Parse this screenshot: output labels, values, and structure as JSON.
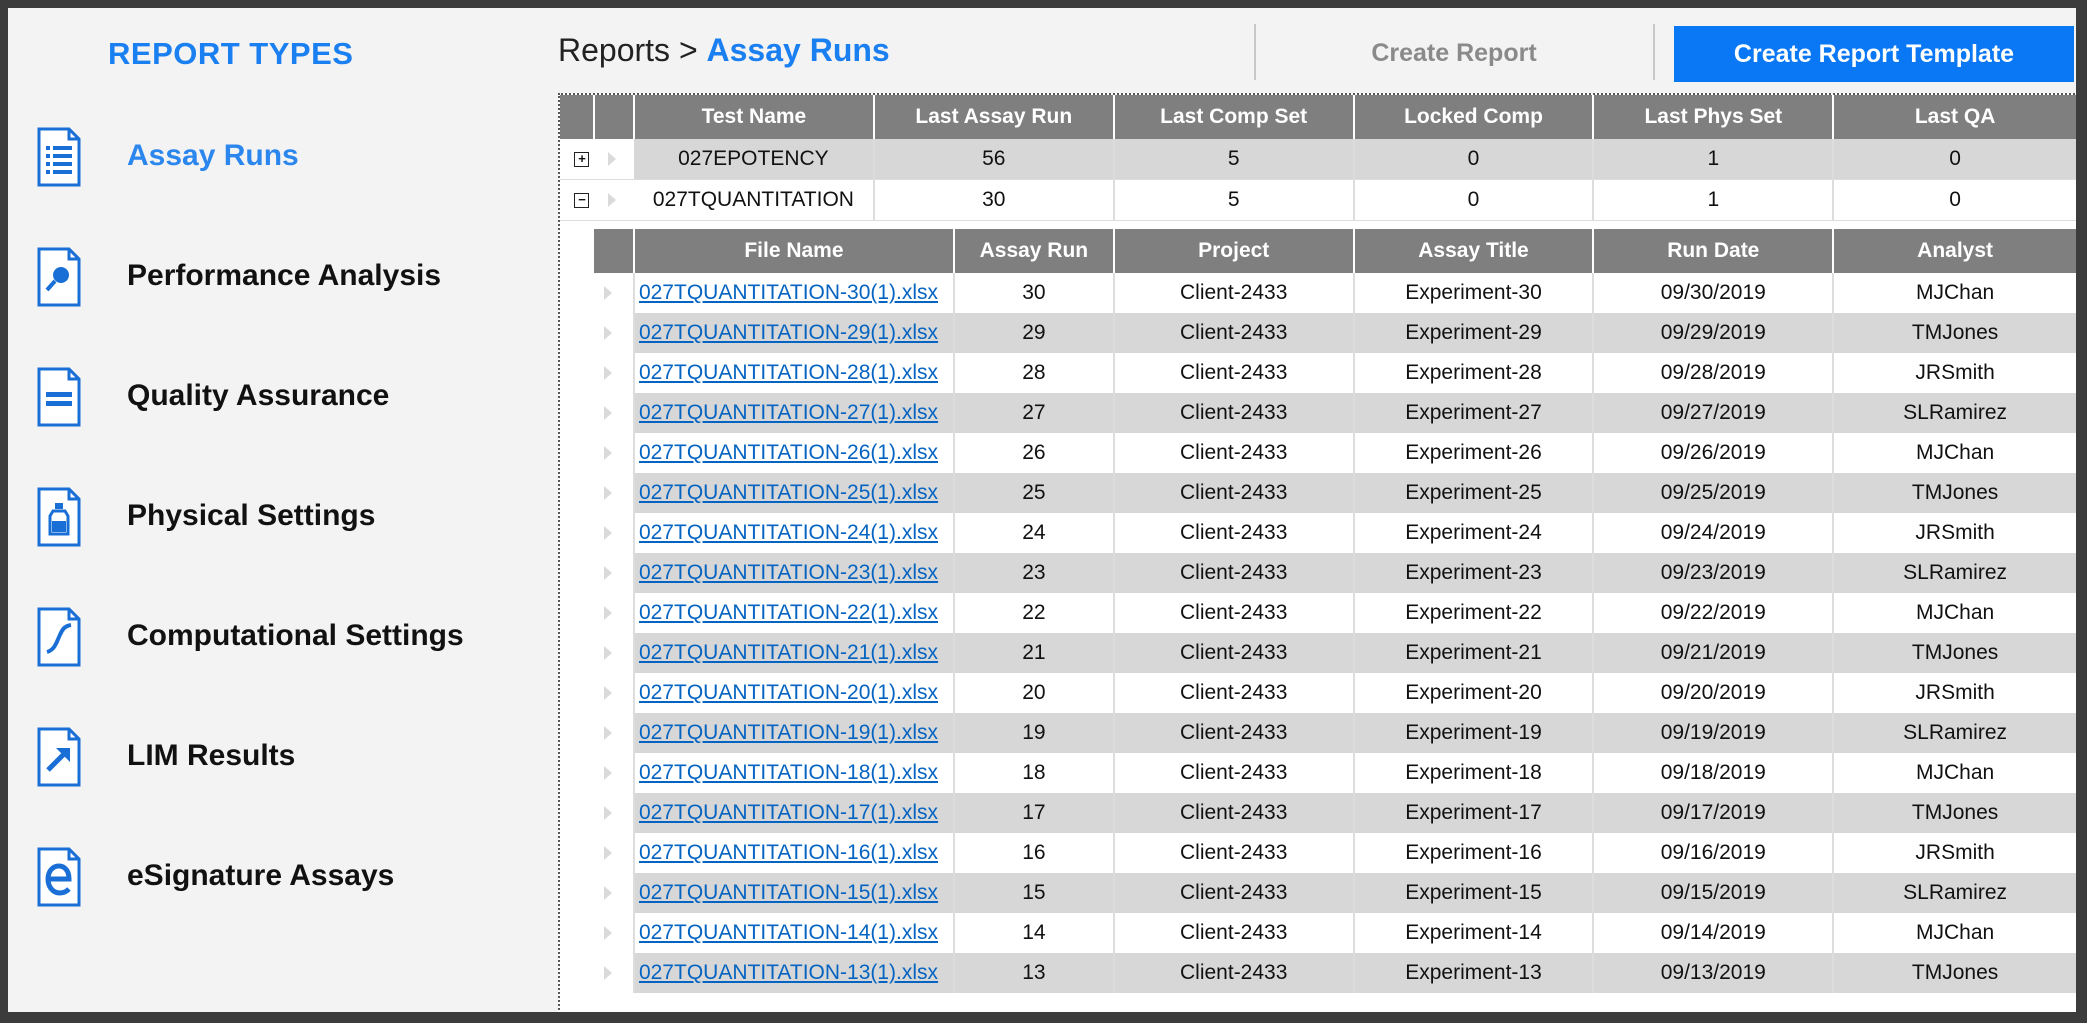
{
  "sidebar": {
    "title": "REPORT TYPES",
    "items": [
      {
        "label": "Assay Runs",
        "icon": "list-document-icon",
        "active": true
      },
      {
        "label": "Performance Analysis",
        "icon": "magnifier-document-icon"
      },
      {
        "label": "Quality Assurance",
        "icon": "equals-document-icon"
      },
      {
        "label": "Physical Settings",
        "icon": "bottle-document-icon"
      },
      {
        "label": "Computational Settings",
        "icon": "curve-document-icon"
      },
      {
        "label": "LIM Results",
        "icon": "arrow-document-icon"
      },
      {
        "label": "eSignature Assays",
        "icon": "e-document-icon"
      }
    ]
  },
  "header": {
    "breadcrumb_root": "Reports",
    "breadcrumb_sep": ">",
    "breadcrumb_current": "Assay Runs",
    "create_report": "Create Report",
    "create_template": "Create Report Template"
  },
  "master": {
    "columns": [
      "Test Name",
      "Last Assay Run",
      "Last Comp Set",
      "Locked Comp",
      "Last Phys Set",
      "Last QA"
    ],
    "rows": [
      {
        "expander": "+",
        "cells": [
          "027EPOTENCY",
          "56",
          "5",
          "0",
          "1",
          "0"
        ]
      },
      {
        "expander": "−",
        "cells": [
          "027TQUANTITATION",
          "30",
          "5",
          "0",
          "1",
          "0"
        ]
      }
    ]
  },
  "detail": {
    "columns": [
      "File Name",
      "Assay Run",
      "Project",
      "Assay Title",
      "Run Date",
      "Analyst"
    ],
    "rows": [
      [
        "027TQUANTITATION-30(1).xlsx",
        "30",
        "Client-2433",
        "Experiment-30",
        "09/30/2019",
        "MJChan"
      ],
      [
        "027TQUANTITATION-29(1).xlsx",
        "29",
        "Client-2433",
        "Experiment-29",
        "09/29/2019",
        "TMJones"
      ],
      [
        "027TQUANTITATION-28(1).xlsx",
        "28",
        "Client-2433",
        "Experiment-28",
        "09/28/2019",
        "JRSmith"
      ],
      [
        "027TQUANTITATION-27(1).xlsx",
        "27",
        "Client-2433",
        "Experiment-27",
        "09/27/2019",
        "SLRamirez"
      ],
      [
        "027TQUANTITATION-26(1).xlsx",
        "26",
        "Client-2433",
        "Experiment-26",
        "09/26/2019",
        "MJChan"
      ],
      [
        "027TQUANTITATION-25(1).xlsx",
        "25",
        "Client-2433",
        "Experiment-25",
        "09/25/2019",
        "TMJones"
      ],
      [
        "027TQUANTITATION-24(1).xlsx",
        "24",
        "Client-2433",
        "Experiment-24",
        "09/24/2019",
        "JRSmith"
      ],
      [
        "027TQUANTITATION-23(1).xlsx",
        "23",
        "Client-2433",
        "Experiment-23",
        "09/23/2019",
        "SLRamirez"
      ],
      [
        "027TQUANTITATION-22(1).xlsx",
        "22",
        "Client-2433",
        "Experiment-22",
        "09/22/2019",
        "MJChan"
      ],
      [
        "027TQUANTITATION-21(1).xlsx",
        "21",
        "Client-2433",
        "Experiment-21",
        "09/21/2019",
        "TMJones"
      ],
      [
        "027TQUANTITATION-20(1).xlsx",
        "20",
        "Client-2433",
        "Experiment-20",
        "09/20/2019",
        "JRSmith"
      ],
      [
        "027TQUANTITATION-19(1).xlsx",
        "19",
        "Client-2433",
        "Experiment-19",
        "09/19/2019",
        "SLRamirez"
      ],
      [
        "027TQUANTITATION-18(1).xlsx",
        "18",
        "Client-2433",
        "Experiment-18",
        "09/18/2019",
        "MJChan"
      ],
      [
        "027TQUANTITATION-17(1).xlsx",
        "17",
        "Client-2433",
        "Experiment-17",
        "09/17/2019",
        "TMJones"
      ],
      [
        "027TQUANTITATION-16(1).xlsx",
        "16",
        "Client-2433",
        "Experiment-16",
        "09/16/2019",
        "JRSmith"
      ],
      [
        "027TQUANTITATION-15(1).xlsx",
        "15",
        "Client-2433",
        "Experiment-15",
        "09/15/2019",
        "SLRamirez"
      ],
      [
        "027TQUANTITATION-14(1).xlsx",
        "14",
        "Client-2433",
        "Experiment-14",
        "09/14/2019",
        "MJChan"
      ],
      [
        "027TQUANTITATION-13(1).xlsx",
        "13",
        "Client-2433",
        "Experiment-13",
        "09/13/2019",
        "TMJones"
      ]
    ]
  },
  "colors": {
    "accent": "#1a7ff0",
    "button": "#0a78f5",
    "header_bg": "#7f7f7f",
    "alt_row": "#d7d7d7",
    "link": "#0563c1"
  }
}
